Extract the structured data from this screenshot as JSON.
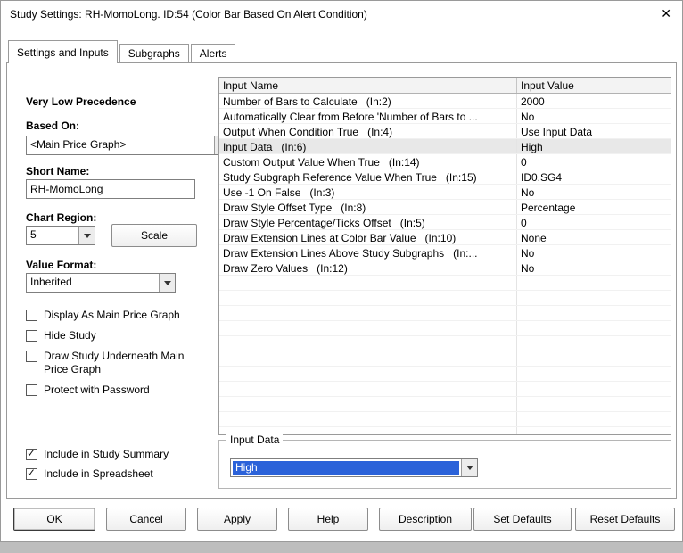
{
  "window": {
    "title": "Study Settings: RH-MomoLong. ID:54 (Color Bar Based On Alert Condition)"
  },
  "icons": {
    "close": "✕",
    "check": "✓"
  },
  "tabs": {
    "settings": "Settings and Inputs",
    "subgraphs": "Subgraphs",
    "alerts": "Alerts"
  },
  "left": {
    "precedence": "Very Low Precedence",
    "based_on_label": "Based On:",
    "based_on_value": "<Main Price Graph>",
    "short_name_label": "Short Name:",
    "short_name_value": "RH-MomoLong",
    "chart_region_label": "Chart Region:",
    "chart_region_value": "5",
    "scale_button": "Scale",
    "value_format_label": "Value Format:",
    "value_format_value": "Inherited",
    "cb_display_main": "Display As Main Price Graph",
    "cb_hide_study": "Hide Study",
    "cb_draw_underneath": "Draw Study Underneath Main Price Graph",
    "cb_protect": "Protect with Password",
    "cb_summary": "Include in Study Summary",
    "cb_spreadsheet": "Include in Spreadsheet"
  },
  "table": {
    "col_name": "Input Name",
    "col_value": "Input Value",
    "rows": [
      {
        "name": "Number of Bars to Calculate   (In:2)",
        "value": "2000",
        "selected": false
      },
      {
        "name": "Automatically Clear from Before 'Number of Bars to ...",
        "value": "No",
        "selected": false
      },
      {
        "name": "Output When Condition True   (In:4)",
        "value": "Use Input Data",
        "selected": false
      },
      {
        "name": "Input Data   (In:6)",
        "value": "High",
        "selected": true
      },
      {
        "name": "Custom Output Value When True   (In:14)",
        "value": "0",
        "selected": false
      },
      {
        "name": "Study Subgraph Reference Value When True   (In:15)",
        "value": "ID0.SG4",
        "selected": false
      },
      {
        "name": "Use -1 On False   (In:3)",
        "value": "No",
        "selected": false
      },
      {
        "name": "Draw Style Offset Type   (In:8)",
        "value": "Percentage",
        "selected": false
      },
      {
        "name": "Draw Style Percentage/Ticks Offset   (In:5)",
        "value": "0",
        "selected": false
      },
      {
        "name": "Draw Extension Lines at Color Bar Value   (In:10)",
        "value": "None",
        "selected": false
      },
      {
        "name": "Draw Extension Lines Above Study Subgraphs   (In:...",
        "value": "No",
        "selected": false
      },
      {
        "name": "Draw Zero Values   (In:12)",
        "value": "No",
        "selected": false
      }
    ]
  },
  "input_data_group": {
    "title": "Input Data",
    "selected_value": "High"
  },
  "buttons": {
    "ok": "OK",
    "cancel": "Cancel",
    "apply": "Apply",
    "help": "Help",
    "description": "Description",
    "set_defaults": "Set Defaults",
    "reset_defaults": "Reset Defaults"
  },
  "colors": {
    "selection_blue": "#2b62d9",
    "selected_row_bg": "#e8e8e8"
  }
}
